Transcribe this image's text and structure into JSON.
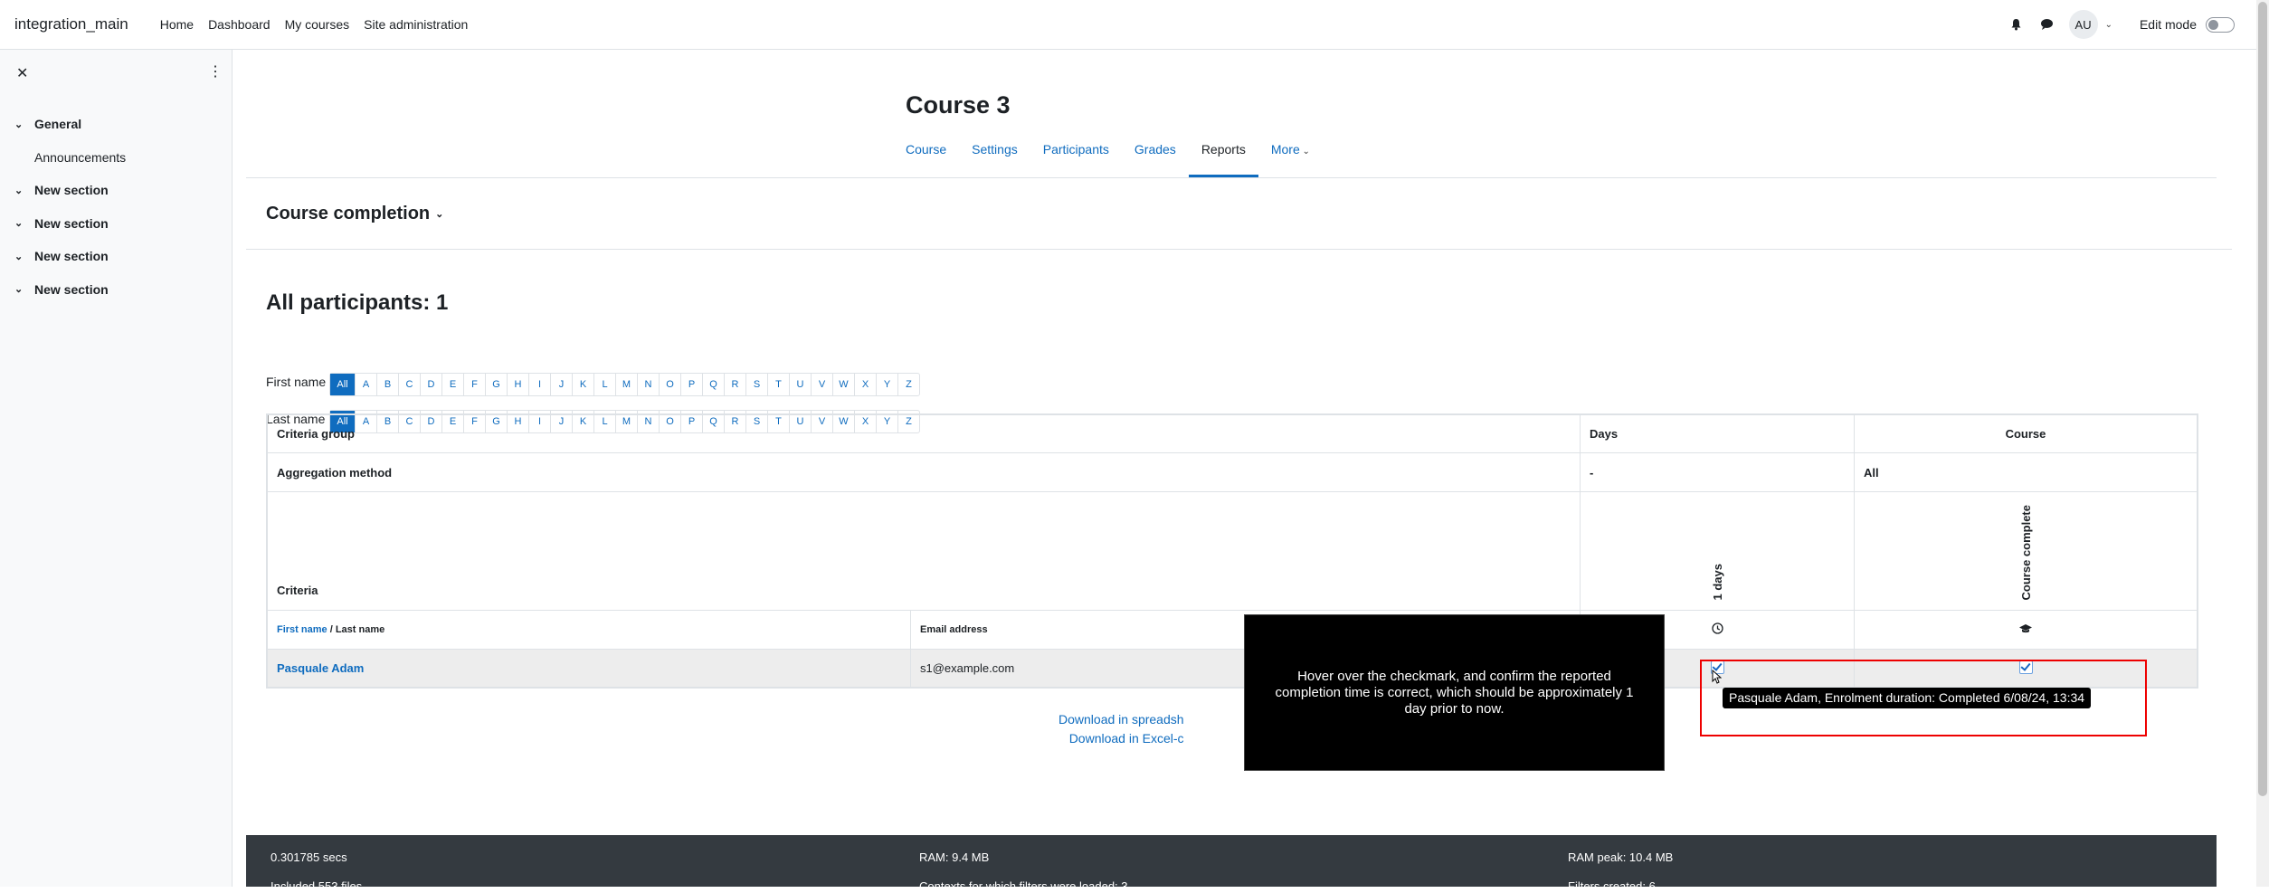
{
  "navbar": {
    "brand": "integration_main",
    "links": [
      "Home",
      "Dashboard",
      "My courses",
      "Site administration"
    ],
    "avatar_initials": "AU",
    "edit_mode_label": "Edit mode"
  },
  "drawer": {
    "items": [
      {
        "type": "section",
        "label": "General"
      },
      {
        "type": "activity",
        "label": "Announcements"
      },
      {
        "type": "section",
        "label": "New section"
      },
      {
        "type": "section",
        "label": "New section"
      },
      {
        "type": "section",
        "label": "New section"
      },
      {
        "type": "section",
        "label": "New section"
      }
    ]
  },
  "course": {
    "title": "Course 3",
    "tabs": [
      "Course",
      "Settings",
      "Participants",
      "Grades",
      "Reports",
      "More"
    ],
    "active_tab": "Reports"
  },
  "report": {
    "selector_label": "Course completion",
    "participants_heading": "All participants: 1",
    "first_name_label": "First name",
    "last_name_label": "Last name",
    "initials": [
      "All",
      "A",
      "B",
      "C",
      "D",
      "E",
      "F",
      "G",
      "H",
      "I",
      "J",
      "K",
      "L",
      "M",
      "N",
      "O",
      "P",
      "Q",
      "R",
      "S",
      "T",
      "U",
      "V",
      "W",
      "X",
      "Y",
      "Z"
    ],
    "criteria_group_label": "Criteria group",
    "criteria_group_days": "Days",
    "criteria_group_course": "Course",
    "aggregation_label": "Aggregation method",
    "aggregation_days": "-",
    "aggregation_course": "All",
    "criteria_label": "Criteria",
    "criteria_days": "1 days",
    "criteria_course": "Course complete",
    "col_first_name": "First name",
    "col_sep": " / ",
    "col_last_name": "Last name",
    "col_email": "Email address",
    "rows": [
      {
        "name": "Pasquale Adam",
        "email": "s1@example.com"
      }
    ],
    "download_spreadsheet": "Download in spreadsh",
    "download_excel": "Download in Excel-c"
  },
  "overlay": {
    "instruction": "Hover over the checkmark, and confirm the reported completion time is correct, which should be approximately 1 day prior to now.",
    "tooltip": "Pasquale Adam, Enrolment duration: Completed 6/08/24, 13:34"
  },
  "footer": {
    "time": "0.301785 secs",
    "ram": "RAM: 9.4 MB",
    "ram_peak": "RAM peak: 10.4 MB",
    "included": "Included 553 files",
    "contexts": "Contexts for which filters were loaded: 3",
    "filters": "Filters created: 6"
  }
}
